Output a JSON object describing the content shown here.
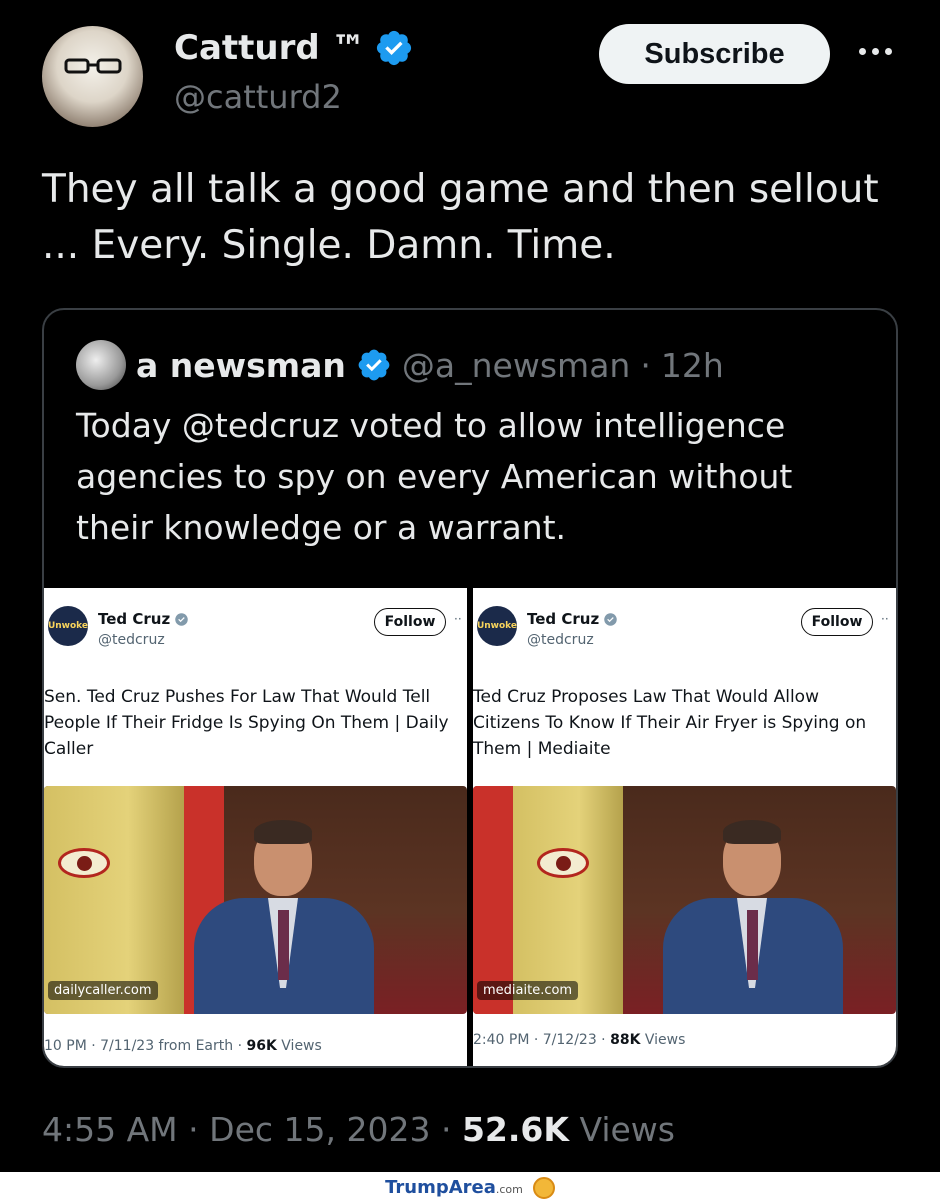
{
  "tweet": {
    "author_name": "Catturd ™",
    "author_handle": "@catturd2",
    "subscribe_label": "Subscribe",
    "text": "They all talk a good game and then sellout ... Every. Single. Damn. Time.",
    "time": "4:55 AM",
    "date": "Dec 15, 2023",
    "views_count": "52.6K",
    "views_label": "Views",
    "separator": "·"
  },
  "quote": {
    "author_name": "a newsman",
    "author_handle": "@a_newsman",
    "age": "12h",
    "separator": "·",
    "text": "Today @tedcruz voted to allow intelligence agencies to spy on every American without their knowledge or a warrant."
  },
  "screenshots": [
    {
      "avatar_text": "Unwoke",
      "name": "Ted Cruz",
      "handle": "@tedcruz",
      "follow_label": "Follow",
      "text": "Sen. Ted Cruz Pushes For Law That Would Tell People If Their Fridge Is Spying On Them | Daily Caller",
      "source": "dailycaller.com",
      "meta": "10 PM · 7/11/23 from Earth · ",
      "views_count": "96K",
      "views_label": "Views"
    },
    {
      "avatar_text": "Unwoke",
      "name": "Ted Cruz",
      "handle": "@tedcruz",
      "follow_label": "Follow",
      "text": "Ted Cruz Proposes Law That Would Allow Citizens To Know If Their Air Fryer is Spying on Them | Mediaite",
      "source": "mediaite.com",
      "meta": "2:40 PM · 7/12/23 · ",
      "views_count": "88K",
      "views_label": "Views"
    }
  ],
  "watermark": {
    "brand": "TrumpArea",
    "suffix": ".com"
  },
  "colors": {
    "background": "#000000",
    "verified_blue": "#1d9bf0",
    "text_primary": "#e7e9ea",
    "text_secondary": "#71767b"
  },
  "icons": [
    "verified-badge-icon",
    "more-options-icon"
  ]
}
